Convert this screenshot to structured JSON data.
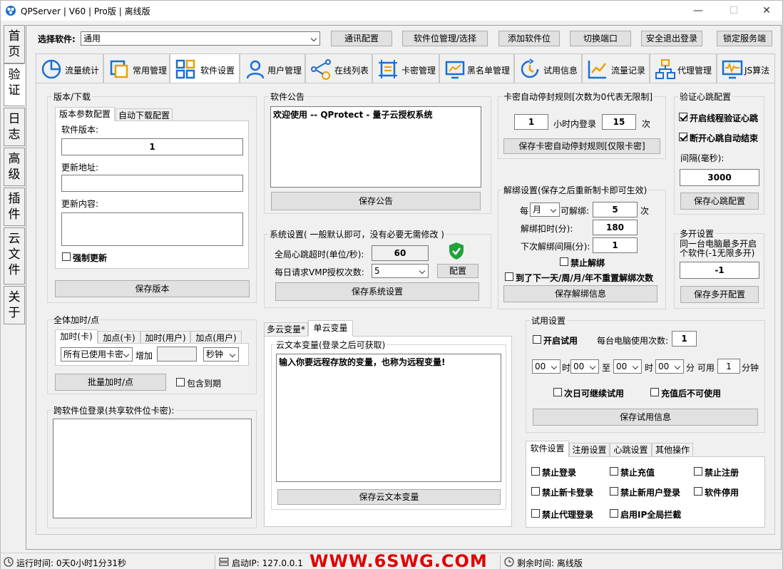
{
  "window": {
    "title": "QPServer |   V60 | Pro版 | 离线版",
    "minimize": "—",
    "maximize": "☐",
    "close": "✕"
  },
  "side_tabs": [
    "首\n页",
    "验\n证",
    "日\n志",
    "高\n级",
    "插\n件",
    "云\n文\n件",
    "关\n于"
  ],
  "toolbar": {
    "select_label": "选择软件:",
    "select_value": "通用",
    "buttons": [
      "通讯配置",
      "软件位管理/选择",
      "添加软件位",
      "切换端口",
      "安全退出登录",
      "锁定服务端"
    ]
  },
  "top_tabs": [
    "流量统计",
    "常用管理",
    "软件设置",
    "用户管理",
    "在线列表",
    "卡密管理",
    "黑名单管理",
    "试用信息",
    "流量记录",
    "代理管理",
    "JS算法"
  ],
  "version": {
    "group_title": "版本/下载",
    "tabs": [
      "版本参数配置",
      "自动下载配置"
    ],
    "version_label": "软件版本:",
    "version_value": "1",
    "url_label": "更新地址:",
    "url_value": "",
    "content_label": "更新内容:",
    "content_value": "",
    "force_update": "强制更新",
    "save": "保存版本"
  },
  "notice": {
    "group_title": "软件公告",
    "text": "欢迎使用 -- QProtect - 量子云授权系统",
    "save": "保存公告"
  },
  "system": {
    "group_title": "系统设置( 一般默认即可，没有必要无需修改 )",
    "heartbeat_label": "全局心跳超时(单位/秒):",
    "heartbeat_value": "60",
    "vmp_label": "每日请求VMP授权次数:",
    "vmp_value": "5",
    "config": "配置",
    "save": "保存系统设置"
  },
  "card_rule": {
    "group_title": "卡密自动停封规则[次数为0代表无限制]",
    "hours_value": "1",
    "mid_label": "小时内登录",
    "times_value": "15",
    "times_unit": "次",
    "save": "保存卡密自动停封规则[仅限卡密]"
  },
  "unbind": {
    "group_title": "解绑设置(保存之后重新制卡即可生效)",
    "per_label": "每",
    "period_value": "月",
    "can_label": "可解绑:",
    "count_value": "5",
    "count_unit": "次",
    "deduct_label": "解绑扣时(分):",
    "deduct_value": "180",
    "interval_label": "下次解绑间隔(分):",
    "interval_value": "1",
    "forbid": "禁止解绑",
    "reset": "到了下一天/周/月/年不重置解绑次数",
    "save": "保存解绑信息"
  },
  "heartbeat": {
    "group_title": "验证心跳配置",
    "enable": "开启线程验证心跳",
    "disconnect": "断开心跳自动结束",
    "interval_label": "间隔(毫秒):",
    "interval_value": "3000",
    "save": "保存心跳配置"
  },
  "multi": {
    "group_title": "多开设置",
    "desc": "同一台电脑最多开启\n个软件(-1无限多开)",
    "value": "-1",
    "save": "保存多开配置"
  },
  "addtime": {
    "group_title": "全体加时/点",
    "tabs": [
      "加时(卡)",
      "加点(卡)",
      "加时(用户)",
      "加点(用户)"
    ],
    "target_value": "所有已使用卡密",
    "add_label": "增加",
    "amount_value": "",
    "unit_value": "秒钟",
    "batch": "批量加时/点",
    "include_expired": "包含到期"
  },
  "cross": {
    "group_title": "跨软件位登录(共享软件位卡密):"
  },
  "cloud": {
    "tabs": [
      "多云变量*",
      "单云变量"
    ],
    "group_title": "云文本变量(登录之后可获取)",
    "text": "输入你要远程存放的变量，也称为远程变量!",
    "save": "保存云文本变量"
  },
  "trial": {
    "group_title": "试用设置",
    "enable": "开启试用",
    "per_pc_label": "每台电脑使用次数:",
    "per_pc_value": "1",
    "h1": "00",
    "hour_label": "时",
    "m1": "00",
    "to_label": "至",
    "h2": "00",
    "hour_label2": "时",
    "m2": "00",
    "min_available": "分 可用",
    "minutes_value": "1",
    "minutes_unit": "分钟",
    "next_day": "次日可继续试用",
    "after_recharge": "充值后不可使用",
    "save": "保存试用信息"
  },
  "soft_tabs": {
    "tabs": [
      "软件设置",
      "注册设置",
      "心跳设置",
      "其他操作"
    ],
    "items": [
      "禁止登录",
      "禁止充值",
      "禁止注册",
      "禁止新卡登录",
      "禁止新用户登录",
      "软件停用",
      "禁止代理登录",
      "启用IP全局拦截"
    ]
  },
  "status": {
    "runtime": "运行时间: 0天0小时1分31秒",
    "ip": "启动IP: 127.0.0.1",
    "watermark": "WWW.6SWG.COM",
    "remaining": "剩余时间: 离线版"
  },
  "colors": {
    "accent": "#1a6fd0",
    "watermark": "#e00000",
    "shield": "#22a33a"
  }
}
